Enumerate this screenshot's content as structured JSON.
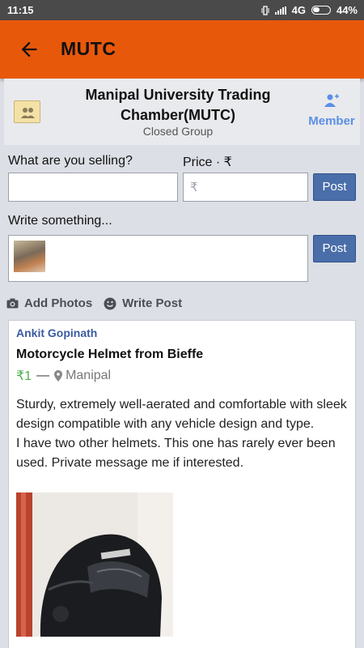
{
  "status_bar": {
    "time": "11:15",
    "network": "4G",
    "battery": "44%"
  },
  "app_bar": {
    "title": "MUTC",
    "back_icon": "arrow-left-icon"
  },
  "group": {
    "name": "Manipal University Trading Chamber(MUTC)",
    "type": "Closed Group",
    "member_label": "Member",
    "member_icon": "add-person-icon"
  },
  "sell_form": {
    "selling_label": "What are you selling?",
    "selling_value": "",
    "price_label": "Price · ₹",
    "price_placeholder": "₹",
    "post_label": "Post"
  },
  "write_form": {
    "label": "Write something...",
    "value": "",
    "post_label": "Post"
  },
  "actions": {
    "add_photos": "Add Photos",
    "write_post": "Write Post"
  },
  "post": {
    "author": "Ankit Gopinath",
    "title": "Motorcycle Helmet from Bieffe",
    "price": "₹1",
    "separator": "—",
    "location": "Manipal",
    "body_1": "Sturdy, extremely well-aerated and comfortable with sleek design compatible with any vehicle design and type.",
    "body_2": "I have two other helmets. This one has rarely ever been used. Private message me if interested."
  },
  "colors": {
    "app_bar": "#e8580b",
    "post_button": "#4a6ea9",
    "price_text": "#4bb04b",
    "author_link": "#3a5ba0",
    "member_button": "#5b8fe6"
  }
}
